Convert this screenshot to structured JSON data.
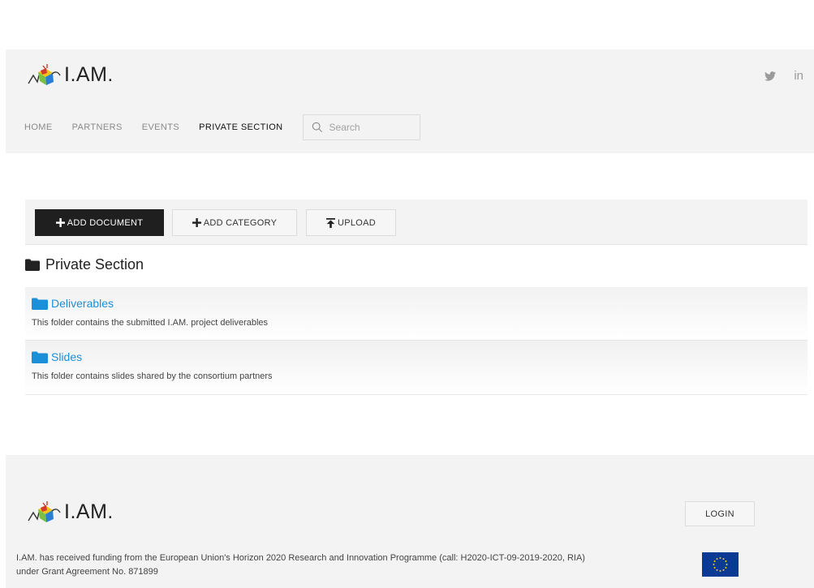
{
  "brand": {
    "name": "I.AM."
  },
  "social": {
    "twitter_icon": "twitter-icon",
    "linkedin_label": "in"
  },
  "nav": {
    "items": [
      "HOME",
      "PARTNERS",
      "EVENTS",
      "PRIVATE SECTION"
    ],
    "active_index": 3
  },
  "search": {
    "placeholder": "Search",
    "value": ""
  },
  "toolbar": {
    "add_document": "ADD DOCUMENT",
    "add_category": "ADD CATEGORY",
    "upload": "UPLOAD"
  },
  "section": {
    "title": "Private Section"
  },
  "folders": [
    {
      "name": "Deliverables",
      "description": "This folder contains the submitted I.AM. project deliverables"
    },
    {
      "name": "Slides",
      "description": "This folder contains slides shared by the consortium partners"
    }
  ],
  "footer": {
    "login_label": "LOGIN",
    "funding_text": "I.AM. has received funding from the European Union's Horizon 2020 Research and Innovation Programme (call: H2020-ICT-09-2019-2020, RIA) under Grant Agreement No. 871899"
  },
  "colors": {
    "accent_link": "#1b8fd8",
    "header_bg": "#f3f3f3",
    "primary_button": "#1f1f1f",
    "eu_blue": "#0a3a94",
    "eu_star": "#f5d20b"
  }
}
